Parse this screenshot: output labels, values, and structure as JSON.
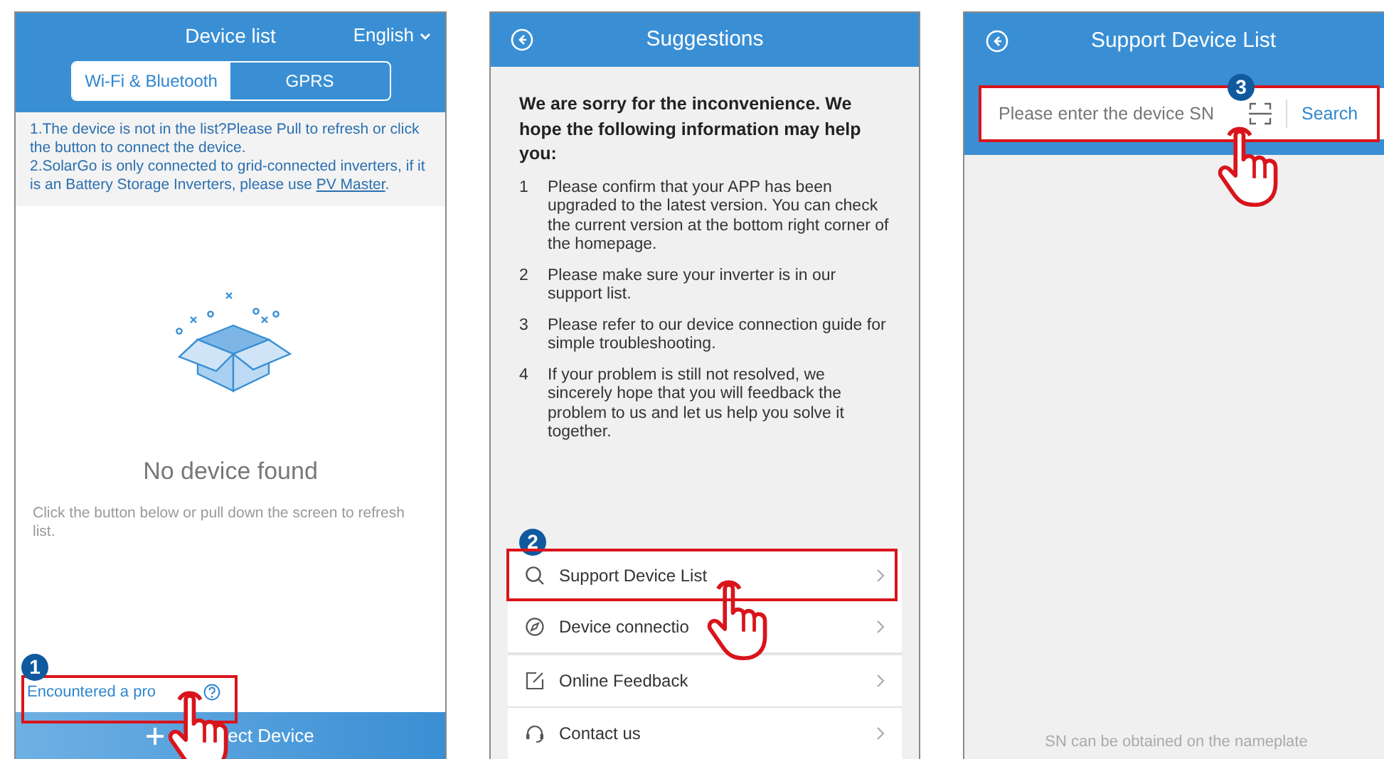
{
  "device_list": {
    "title": "Device list",
    "language": "English",
    "tabs": [
      {
        "label": "Wi-Fi & Bluetooth",
        "selected": true
      },
      {
        "label": "GPRS",
        "selected": false
      }
    ],
    "notes": [
      {
        "text": "1.The device is not in the list?Please Pull to refresh or click the button to connect the device."
      },
      {
        "text": "2.SolarGo is only connected to grid-connected inverters, if it is an Battery Storage Inverters, please use ",
        "link": "PV Master",
        "after": "."
      }
    ],
    "empty_title": "No device found",
    "empty_hint": "Click the button below or pull down the screen to refresh list.",
    "problem_link": "Encountered a pro",
    "connect_button": "ect Device",
    "step": "1"
  },
  "suggestions": {
    "title": "Suggestions",
    "intro": "We are sorry for the inconvenience. We hope the following information may help you:",
    "items": [
      {
        "number": "1",
        "text": "Please confirm that your APP has been upgraded to the latest version. You can check the current version at the bottom right corner of the homepage."
      },
      {
        "number": "2",
        "text": "Please make sure your inverter is in our support list."
      },
      {
        "number": "3",
        "text": "Please refer to our device connection guide for simple troubleshooting."
      },
      {
        "number": "4",
        "text": "If your problem is still not resolved, we sincerely hope that you will feedback the problem to us and let us help you solve it together."
      }
    ],
    "menu": [
      {
        "kind": "search",
        "label": "Support Device List",
        "highlighted": true
      },
      {
        "kind": "compass",
        "label": "Device connectio",
        "highlighted": false
      },
      {
        "kind": "feedback",
        "label": "Online Feedback",
        "highlighted": false
      },
      {
        "kind": "headset",
        "label": "Contact us",
        "highlighted": false
      }
    ],
    "step": "2"
  },
  "support_list": {
    "title": "Support Device List",
    "search": {
      "placeholder": "Please enter the device SN",
      "button": "Search"
    },
    "footer": "SN can be obtained on the nameplate",
    "step": "3"
  }
}
